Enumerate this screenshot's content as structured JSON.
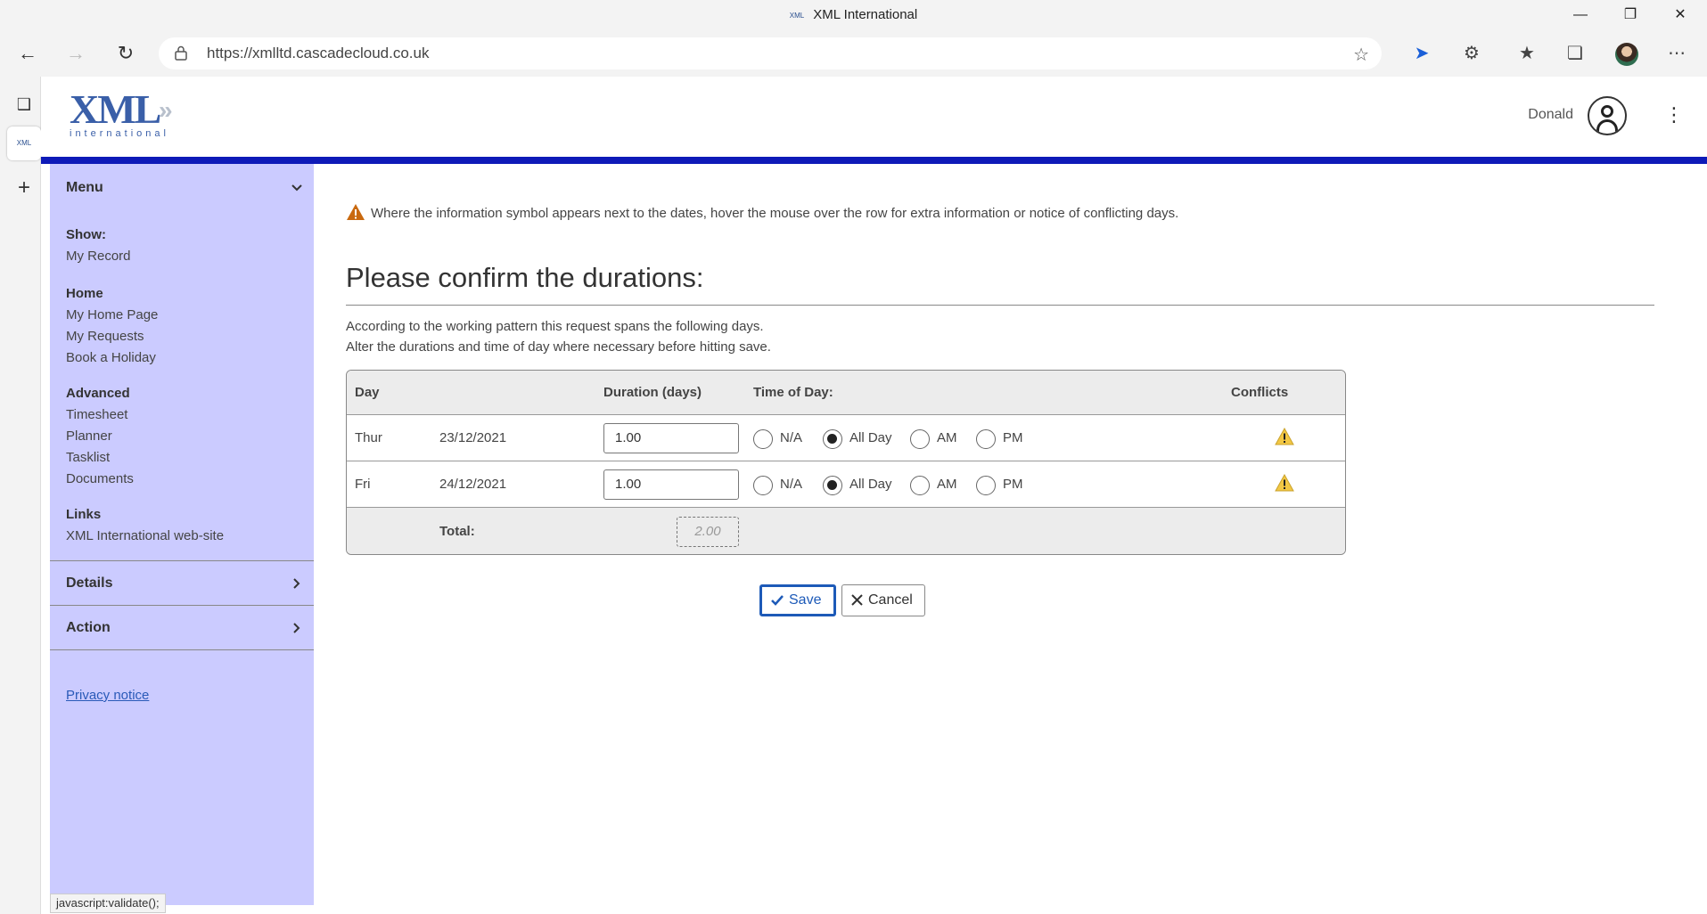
{
  "window": {
    "title": "XML International",
    "favicon_text": "XML",
    "min_icon": "minimize-icon",
    "restore_icon": "restore-icon",
    "close_icon": "close-icon"
  },
  "browser": {
    "url": "https://xmlltd.cascadecloud.co.uk",
    "toolbar_icons": [
      "back-icon",
      "forward-icon",
      "refresh-icon",
      "lock-icon",
      "add-favorite-icon",
      "copilot-icon",
      "extensions-icon",
      "favorites-icon",
      "collections-icon",
      "profile-icon",
      "more-icon"
    ]
  },
  "tabstrip": {
    "active_tab_text": "XML"
  },
  "header": {
    "logo_text": "XML",
    "logo_subtext": "international",
    "username": "Donald"
  },
  "sidebar": {
    "menu_label": "Menu",
    "groups": [
      {
        "heading": "Show:",
        "links": [
          "My Record"
        ]
      },
      {
        "heading": "Home",
        "links": [
          "My Home Page",
          "My Requests",
          "Book a Holiday"
        ]
      },
      {
        "heading": "Advanced",
        "links": [
          "Timesheet",
          "Planner",
          "Tasklist",
          "Documents"
        ]
      },
      {
        "heading": "Links",
        "links": [
          "XML International web-site"
        ]
      }
    ],
    "details_label": "Details",
    "action_label": "Action",
    "privacy_label": "Privacy notice"
  },
  "main": {
    "notice": "Where the information symbol appears next to the dates, hover the mouse over the row for extra information or notice of conflicting days.",
    "heading": "Please confirm the durations:",
    "desc_line1": "According to the working pattern this request spans the following days.",
    "desc_line2": "Alter the durations and time of day where necessary before hitting save.",
    "table": {
      "headers": {
        "day": "Day",
        "duration": "Duration (days)",
        "time_of_day": "Time of Day:",
        "conflicts": "Conflicts"
      },
      "radio_labels": {
        "na": "N/A",
        "allday": "All Day",
        "am": "AM",
        "pm": "PM"
      },
      "rows": [
        {
          "day": "Thur",
          "date": "23/12/2021",
          "duration": "1.00",
          "selected": "allday"
        },
        {
          "day": "Fri",
          "date": "24/12/2021",
          "duration": "1.00",
          "selected": "allday"
        }
      ],
      "total_label": "Total:",
      "total_value": "2.00"
    },
    "save_label": "Save",
    "cancel_label": "Cancel"
  },
  "statusbar": "javascript:validate();",
  "colors": {
    "accent_band": "#0e1ab8",
    "sidebar_bg": "#cbcbff",
    "save_border": "#1d5ab8",
    "warning": "#f2c744"
  }
}
